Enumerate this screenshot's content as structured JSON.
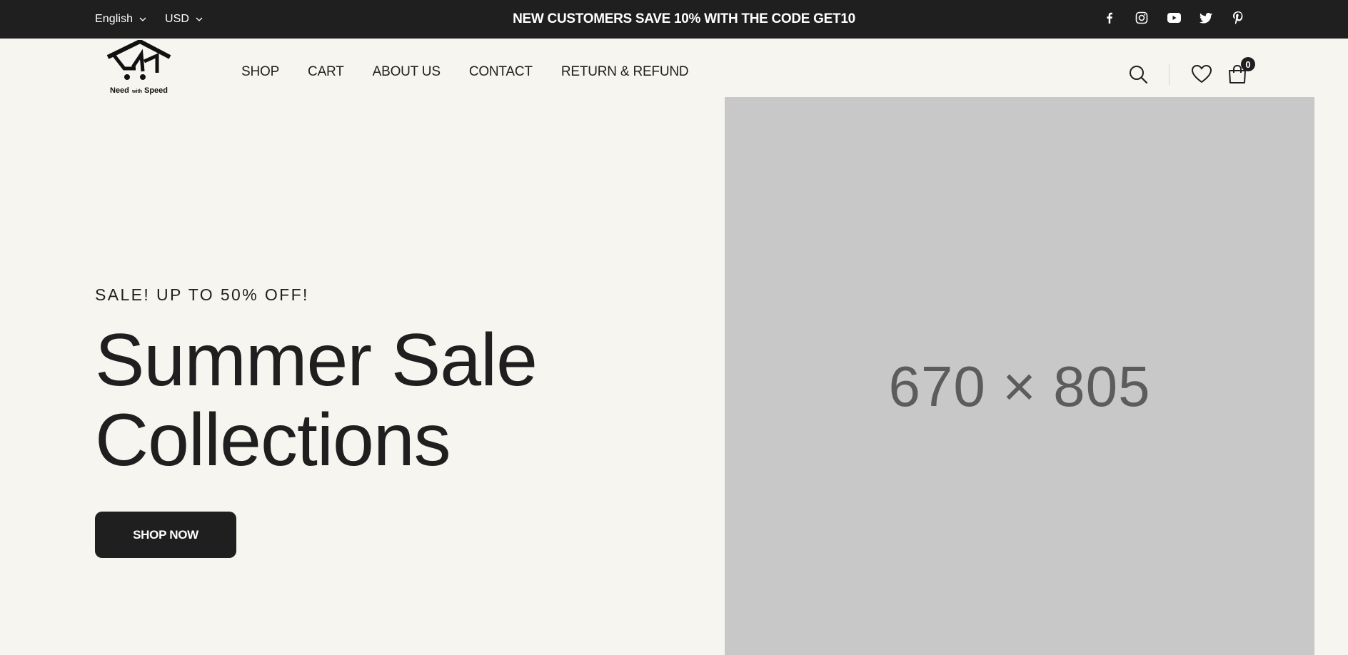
{
  "topbar": {
    "language": "English",
    "currency": "USD",
    "promo": "NEW CUSTOMERS SAVE 10% WITH THE CODE GET10",
    "socials": [
      "facebook-icon",
      "instagram-icon",
      "youtube-icon",
      "twitter-icon",
      "pinterest-icon"
    ]
  },
  "header": {
    "logo_text": "Need with Speed",
    "nav": [
      "SHOP",
      "CART",
      "ABOUT US",
      "CONTACT",
      "RETURN & REFUND"
    ],
    "cart_count": "0",
    "icons": [
      "search-icon",
      "heart-icon",
      "shopping-bag-icon"
    ]
  },
  "hero": {
    "eyebrow": "SALE! UP TO 50% OFF!",
    "headline_line1": "Summer Sale",
    "headline_line2": "Collections",
    "cta": "SHOP NOW",
    "image_placeholder": "670 × 805"
  },
  "colors": {
    "background": "#f7f5f0",
    "dark": "#1f1f1f",
    "placeholder": "#c8c8c8"
  }
}
